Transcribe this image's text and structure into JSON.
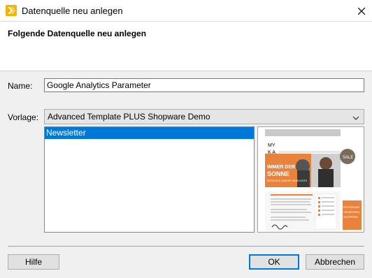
{
  "window": {
    "title": "Datenquelle neu anlegen"
  },
  "header": {
    "title": "Folgende Datenquelle neu anlegen"
  },
  "form": {
    "name_label": "Name:",
    "name_value": "Google Analytics Parameter",
    "template_label": "Vorlage:",
    "template_value": "Advanced Template PLUS Shopware Demo"
  },
  "list": {
    "items": [
      "Newsletter"
    ],
    "selected_index": 0
  },
  "preview": {
    "logo": "MY K A",
    "headline_1": "IMMER DER",
    "headline_2": "SONNE",
    "subline": "ENTDECKE UNSERE HIGHLIGHTS",
    "sale_badge": "SALE",
    "side_banner": "ENTSPANNT GENIESSEN, SHOPPEN!"
  },
  "buttons": {
    "help": "Hilfe",
    "ok": "OK",
    "cancel": "Abbrechen"
  },
  "colors": {
    "accent": "#0078d7",
    "app_icon": "#f2b400",
    "banner": "#e8823c"
  }
}
